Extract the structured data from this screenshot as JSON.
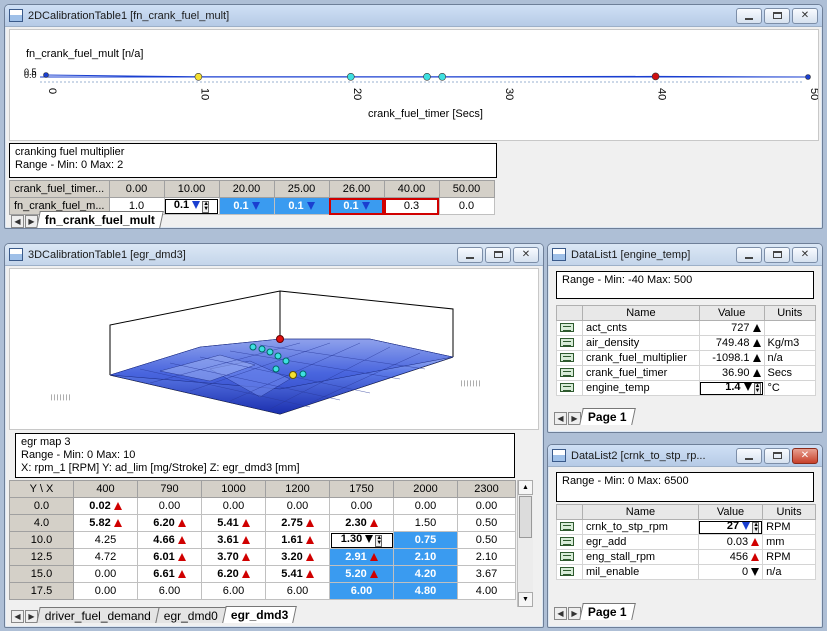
{
  "win2d": {
    "title": "2DCalibrationTable1 [fn_crank_fuel_mult]",
    "chart_data": {
      "type": "line",
      "ylabel": "fn_crank_fuel_mult [n/a]",
      "xlabel": "crank_fuel_timer [Secs]",
      "y_ticks": [
        "0.5",
        "0.0"
      ],
      "x_ticks": [
        "0",
        "10",
        "20",
        "30",
        "40",
        "50"
      ],
      "xlim": [
        0,
        50
      ],
      "points": [
        {
          "x": 0,
          "y": 1.0,
          "marker": "blue"
        },
        {
          "x": 10,
          "y": 0.1,
          "marker": "yellow"
        },
        {
          "x": 20,
          "y": 0.1,
          "marker": "cyan"
        },
        {
          "x": 25,
          "y": 0.1,
          "marker": "cyan"
        },
        {
          "x": 26,
          "y": 0.1,
          "marker": "cyan"
        },
        {
          "x": 40,
          "y": 0.3,
          "marker": "red"
        },
        {
          "x": 50,
          "y": 0.0,
          "marker": "blue"
        }
      ]
    },
    "info": {
      "line1": "cranking fuel multiplier",
      "line2": "Range -  Min: 0   Max: 2"
    },
    "table": {
      "x_header": "crank_fuel_timer...",
      "x_values": [
        "0.00",
        "10.00",
        "20.00",
        "25.00",
        "26.00",
        "40.00",
        "50.00"
      ],
      "row_label": "fn_crank_fuel_m...",
      "y_values": [
        "1.0",
        "0.1",
        "0.1",
        "0.1",
        "0.1",
        "0.3",
        "0.0"
      ]
    },
    "tab": "fn_crank_fuel_mult"
  },
  "win3d": {
    "title": "3DCalibrationTable1 [egr_dmd3]",
    "info": {
      "line1": "egr map 3",
      "line2": "Range -  Min: 0   Max: 10",
      "line3": "X: rpm_1 [RPM]   Y: ad_lim [mg/Stroke]   Z: egr_dmd3 [mm]"
    },
    "corner": "Y  \\  X",
    "x_headers": [
      "400",
      "790",
      "1000",
      "1200",
      "1750",
      "2000",
      "2300"
    ],
    "rows": [
      {
        "y": "0.0",
        "cells": [
          "0.02",
          "0.00",
          "0.00",
          "0.00",
          "0.00",
          "0.00",
          "0.00"
        ]
      },
      {
        "y": "4.0",
        "cells": [
          "5.82",
          "6.20",
          "5.41",
          "2.75",
          "2.30",
          "1.50",
          "0.50"
        ]
      },
      {
        "y": "10.0",
        "cells": [
          "4.25",
          "4.66",
          "3.61",
          "1.61",
          "1.30",
          "0.75",
          "0.50"
        ]
      },
      {
        "y": "12.5",
        "cells": [
          "4.72",
          "6.01",
          "3.70",
          "3.20",
          "2.91",
          "2.10",
          "2.10"
        ]
      },
      {
        "y": "15.0",
        "cells": [
          "0.00",
          "6.61",
          "6.20",
          "5.41",
          "5.20",
          "4.20",
          "3.67"
        ]
      },
      {
        "y": "17.5",
        "cells": [
          "0.00",
          "6.00",
          "6.00",
          "6.00",
          "6.00",
          "4.80",
          "4.00"
        ]
      }
    ],
    "tabs": [
      "driver_fuel_demand",
      "egr_dmd0",
      "egr_dmd3"
    ]
  },
  "dl1": {
    "title": "DataList1 [engine_temp]",
    "range": "Range -  Min: -40   Max: 500",
    "headers": {
      "name": "Name",
      "value": "Value",
      "units": "Units"
    },
    "rows": [
      {
        "name": "act_cnts",
        "value": "727",
        "units": ""
      },
      {
        "name": "air_density",
        "value": "749.48",
        "units": "Kg/m3"
      },
      {
        "name": "crank_fuel_multiplier",
        "value": "-1098.1",
        "units": "n/a"
      },
      {
        "name": "crank_fuel_timer",
        "value": "36.90",
        "units": "Secs"
      },
      {
        "name": "engine_temp",
        "value": "1.4",
        "units": "°C"
      }
    ],
    "tab": "Page 1"
  },
  "dl2": {
    "title": "DataList2 [crnk_to_stp_rp...",
    "range": "Range -  Min: 0   Max: 6500",
    "headers": {
      "name": "Name",
      "value": "Value",
      "units": "Units"
    },
    "rows": [
      {
        "name": "crnk_to_stp_rpm",
        "value": "27",
        "units": "RPM"
      },
      {
        "name": "egr_add",
        "value": "0.03",
        "units": "mm"
      },
      {
        "name": "eng_stall_rpm",
        "value": "456",
        "units": "RPM"
      },
      {
        "name": "mil_enable",
        "value": "0",
        "units": "n/a"
      }
    ],
    "tab": "Page 1"
  },
  "colors": {
    "selection": "#3a9bf0",
    "edit_box": "#d00000",
    "up_arrow": "#d00000",
    "down_arrow": "#1a3fd0"
  }
}
